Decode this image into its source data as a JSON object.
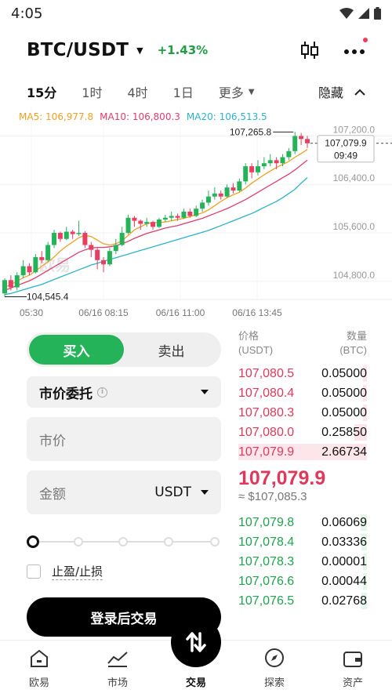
{
  "status": {
    "time": "4:05"
  },
  "header": {
    "pair": "BTC/USDT",
    "change": "+1.43%"
  },
  "timeframes": {
    "tabs": [
      "15分",
      "1时",
      "4时",
      "1日"
    ],
    "active": "15分",
    "more": "更多",
    "hide": "隐藏"
  },
  "chart": {
    "ma5": "MA5: 106,977.8",
    "ma10": "MA10: 106,800.3",
    "ma20": "MA20: 106,513.5",
    "high_label": "107,265.8",
    "low_label": "104,545.4",
    "price_tag": "107,079.9",
    "countdown": "09:49",
    "watermark": "欧易",
    "y_ticks": [
      "107,200.0",
      "106,400.0",
      "105,600.0",
      "104,800.0"
    ],
    "x_ticks": [
      "05:30",
      "06/16 08:15",
      "06/16 11:00",
      "06/16 13:45"
    ]
  },
  "chart_data": {
    "type": "candlestick",
    "y_ticks": [
      107200,
      106400,
      105600,
      104800
    ],
    "x_ticks": [
      "05:30",
      "06/16 08:15",
      "06/16 11:00",
      "06/16 13:45"
    ],
    "ylim": [
      104500,
      107400
    ],
    "candles": [
      [
        104600,
        104820,
        104545,
        104850
      ],
      [
        104820,
        104700,
        104650,
        104900
      ],
      [
        104700,
        104900,
        104650,
        104950
      ],
      [
        104900,
        105050,
        104850,
        105150
      ],
      [
        105050,
        104950,
        104900,
        105100
      ],
      [
        104950,
        105200,
        104930,
        105250
      ],
      [
        105200,
        105150,
        105100,
        105300
      ],
      [
        105150,
        105400,
        105120,
        105450
      ],
      [
        105400,
        105600,
        105350,
        105650
      ],
      [
        105600,
        105500,
        105450,
        105620
      ],
      [
        105500,
        105620,
        105480,
        105700
      ],
      [
        105620,
        105580,
        105500,
        105650
      ],
      [
        105580,
        105600,
        105550,
        105800
      ],
      [
        105600,
        105400,
        105350,
        105630
      ],
      [
        105400,
        105320,
        105200,
        105450
      ],
      [
        105320,
        105150,
        105000,
        105350
      ],
      [
        105150,
        105080,
        104950,
        105200
      ],
      [
        105080,
        105300,
        105050,
        105350
      ],
      [
        105300,
        105400,
        105250,
        105500
      ],
      [
        105400,
        105600,
        105380,
        105700
      ],
      [
        105600,
        105850,
        105580,
        105900
      ],
      [
        105850,
        105800,
        105700,
        105880
      ],
      [
        105800,
        105750,
        105650,
        105820
      ],
      [
        105750,
        105780,
        105700,
        105850
      ],
      [
        105780,
        105700,
        105650,
        105800
      ],
      [
        105700,
        105820,
        105680,
        105850
      ],
      [
        105820,
        105850,
        105780,
        105900
      ],
      [
        105850,
        105880,
        105800,
        105950
      ],
      [
        105880,
        105850,
        105800,
        105920
      ],
      [
        105850,
        105950,
        105830,
        106000
      ],
      [
        105950,
        105880,
        105850,
        106000
      ],
      [
        105880,
        106000,
        105860,
        106050
      ],
      [
        106000,
        106100,
        105950,
        106150
      ],
      [
        106100,
        106200,
        106050,
        106300
      ],
      [
        106200,
        106250,
        106150,
        106350
      ],
      [
        106250,
        106200,
        106150,
        106300
      ],
      [
        106200,
        106350,
        106180,
        106400
      ],
      [
        106350,
        106300,
        106250,
        106420
      ],
      [
        106300,
        106450,
        106280,
        106500
      ],
      [
        106450,
        106700,
        106400,
        106750
      ],
      [
        106700,
        106600,
        106500,
        106750
      ],
      [
        106600,
        106700,
        106550,
        106800
      ],
      [
        106700,
        106750,
        106650,
        106850
      ],
      [
        106750,
        106800,
        106700,
        106900
      ],
      [
        106800,
        106750,
        106650,
        106850
      ],
      [
        106750,
        106850,
        106700,
        106900
      ],
      [
        106850,
        106950,
        106800,
        107000
      ],
      [
        106950,
        107200,
        106900,
        107265.8
      ],
      [
        107200,
        107150,
        107050,
        107250
      ],
      [
        107150,
        107079.9,
        107000,
        107200
      ]
    ],
    "series": [
      {
        "name": "MA5",
        "values": [
          104700,
          104750,
          104800,
          104860,
          104900,
          104970,
          105050,
          105120,
          105200,
          105300,
          105380,
          105450,
          105520,
          105560,
          105540,
          105480,
          105420,
          105400,
          105420,
          105470,
          105560,
          105650,
          105700,
          105750,
          105770,
          105770,
          105780,
          105800,
          105820,
          105840,
          105870,
          105900,
          105930,
          105980,
          106050,
          106120,
          106180,
          106230,
          106270,
          106340,
          106420,
          106490,
          106560,
          106620,
          106680,
          106730,
          106780,
          106850,
          106910,
          106977.8
        ]
      },
      {
        "name": "MA10",
        "values": [
          104650,
          104690,
          104730,
          104770,
          104810,
          104860,
          104920,
          104980,
          105040,
          105100,
          105160,
          105220,
          105280,
          105320,
          105350,
          105360,
          105360,
          105370,
          105390,
          105420,
          105460,
          105510,
          105550,
          105590,
          105620,
          105650,
          105680,
          105700,
          105720,
          105750,
          105780,
          105810,
          105840,
          105880,
          105920,
          105960,
          106000,
          106050,
          106100,
          106150,
          106210,
          106270,
          106330,
          106390,
          106450,
          106510,
          106570,
          106640,
          106720,
          106800.3
        ]
      },
      {
        "name": "MA20",
        "values": [
          104580,
          104600,
          104630,
          104660,
          104690,
          104720,
          104750,
          104790,
          104830,
          104870,
          104910,
          104950,
          104990,
          105030,
          105070,
          105100,
          105130,
          105160,
          105190,
          105220,
          105250,
          105280,
          105310,
          105340,
          105370,
          105400,
          105430,
          105460,
          105490,
          105520,
          105550,
          105580,
          105610,
          105640,
          105680,
          105720,
          105760,
          105800,
          105840,
          105880,
          105920,
          105970,
          106020,
          106070,
          106120,
          106180,
          106250,
          106320,
          106420,
          106513.5
        ]
      }
    ]
  },
  "form": {
    "buy": "买入",
    "sell": "卖出",
    "order_type": "市价委托",
    "price_placeholder": "市价",
    "amount_placeholder": "金额",
    "currency": "USDT",
    "tpsl": "止盈/止损",
    "login_button": "登录后交易"
  },
  "orderbook": {
    "price_header": "价格",
    "price_unit": "(USDT)",
    "qty_header": "数量",
    "qty_unit": "(BTC)",
    "asks": [
      {
        "price": "107,080.5",
        "qty": "0.05000",
        "depth": 0.03
      },
      {
        "price": "107,080.4",
        "qty": "0.05000",
        "depth": 0.03
      },
      {
        "price": "107,080.3",
        "qty": "0.05000",
        "depth": 0.03
      },
      {
        "price": "107,080.0",
        "qty": "0.25850",
        "depth": 0.1
      },
      {
        "price": "107,079.9",
        "qty": "2.66734",
        "depth": 1.0
      }
    ],
    "last_price": "107,079.9",
    "usd_price": "≈ $107,085.3",
    "bids": [
      {
        "price": "107,079.8",
        "qty": "0.06069",
        "depth": 0.05
      },
      {
        "price": "107,078.4",
        "qty": "0.03336",
        "depth": 0.04
      },
      {
        "price": "107,078.3",
        "qty": "0.00001",
        "depth": 0.03
      },
      {
        "price": "107,076.6",
        "qty": "0.00044",
        "depth": 0.03
      },
      {
        "price": "107,076.5",
        "qty": "0.02768",
        "depth": 0.04
      }
    ]
  },
  "nav": {
    "items": [
      "欧易",
      "市场",
      "交易",
      "探索",
      "资产"
    ],
    "active": "交易"
  }
}
